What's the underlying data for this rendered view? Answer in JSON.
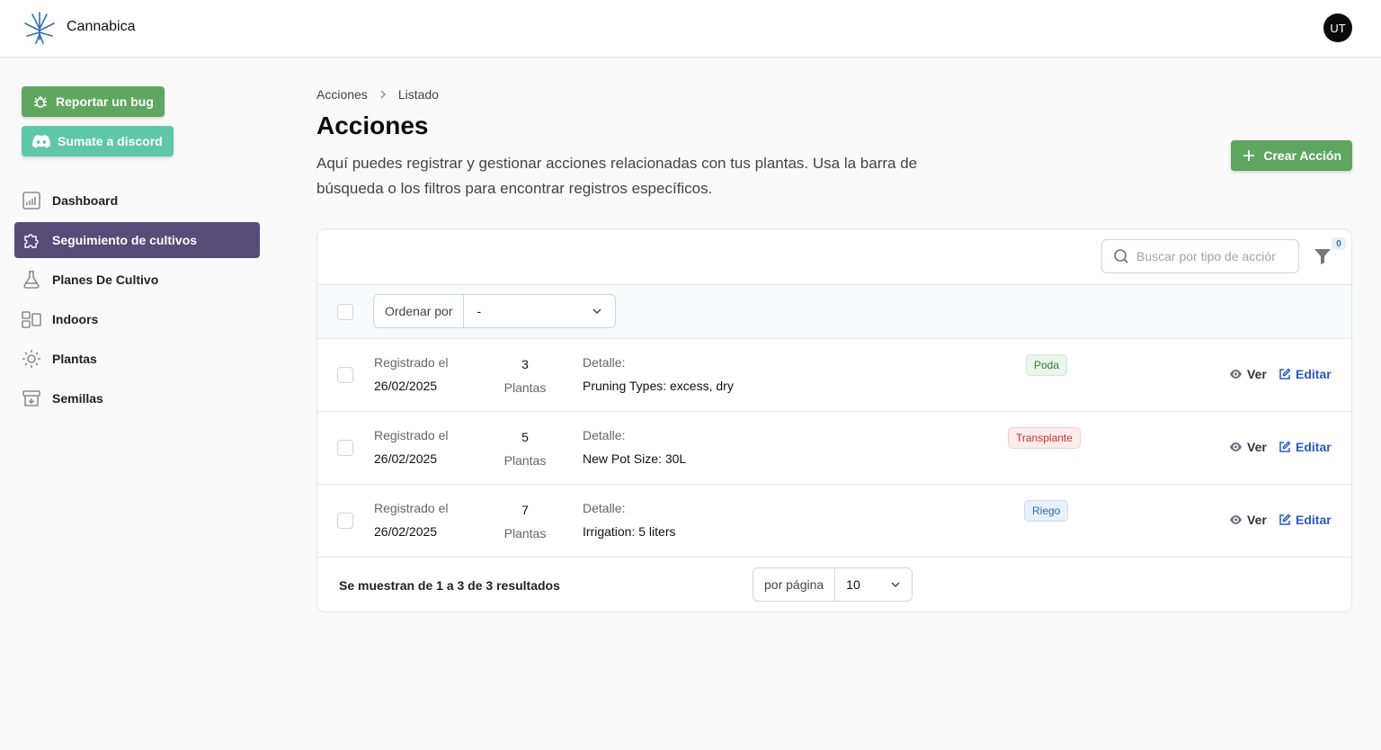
{
  "app": {
    "name": "Cannabica",
    "user_initials": "UT"
  },
  "sidebar": {
    "report_bug_label": "Reportar un bug",
    "discord_label": "Sumate a discord",
    "items": [
      {
        "label": "Dashboard",
        "icon": "chart-icon"
      },
      {
        "label": "Seguimiento de cultivos",
        "icon": "puzzle-icon",
        "active": true
      },
      {
        "label": "Planes De Cultivo",
        "icon": "flask-icon"
      },
      {
        "label": "Indoors",
        "icon": "indoor-icon"
      },
      {
        "label": "Plantas",
        "icon": "sun-icon"
      },
      {
        "label": "Semillas",
        "icon": "archive-icon"
      }
    ]
  },
  "breadcrumb": {
    "parent": "Acciones",
    "current": "Listado"
  },
  "page": {
    "title": "Acciones",
    "description": "Aquí puedes registrar y gestionar acciones relacionadas con tus plantas. Usa la barra de búsqueda o los filtros para encontrar registros específicos.",
    "create_label": "Crear Acción"
  },
  "table": {
    "search_placeholder": "Buscar por tipo de acción",
    "filter_count": "0",
    "sort_label": "Ordenar por",
    "sort_value": "-",
    "rows": [
      {
        "registered_label": "Registrado el",
        "date": "26/02/2025",
        "qty": "3",
        "qty_label": "Plantas",
        "detail_label": "Detalle:",
        "detail": "Pruning Types: excess, dry",
        "badge": "Poda",
        "view": "Ver",
        "edit": "Editar"
      },
      {
        "registered_label": "Registrado el",
        "date": "26/02/2025",
        "qty": "5",
        "qty_label": "Plantas",
        "detail_label": "Detalle:",
        "detail": "New Pot Size: 30L",
        "badge": "Transplante",
        "view": "Ver",
        "edit": "Editar"
      },
      {
        "registered_label": "Registrado el",
        "date": "26/02/2025",
        "qty": "7",
        "qty_label": "Plantas",
        "detail_label": "Detalle:",
        "detail": "Irrigation: 5 liters",
        "badge": "Riego",
        "view": "Ver",
        "edit": "Editar"
      }
    ],
    "results_text": "Se muestran de 1 a 3 de 3 resultados",
    "per_page_label": "por página",
    "per_page_value": "10"
  },
  "colors": {
    "primary_green": "#5fa661",
    "discord_teal": "#5ec7a9",
    "active_nav": "#574b78",
    "edit_blue": "#2b59c3"
  }
}
